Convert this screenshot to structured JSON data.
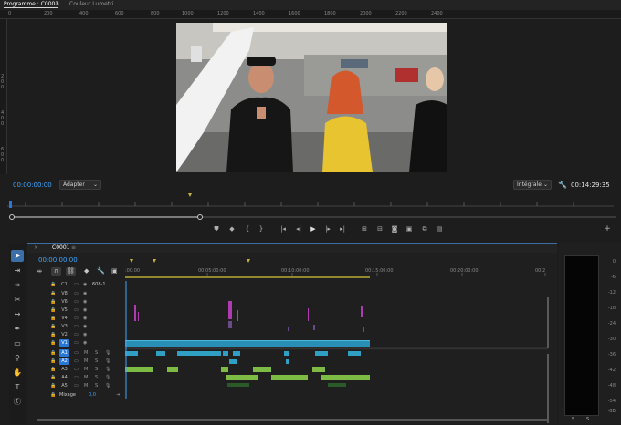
{
  "monitor": {
    "tab_program": "Programme : C0001",
    "tab_menu_icon": "≡",
    "tab_lumetri": "Couleur Lumetri",
    "ruler_labels": [
      "0",
      "200",
      "400",
      "600",
      "800",
      "1000",
      "1200",
      "1400",
      "1600",
      "1800",
      "2000",
      "2200",
      "2400"
    ],
    "ruler_left_labels": [
      "2",
      "0",
      "0",
      "4",
      "0",
      "0",
      "6",
      "0",
      "0"
    ],
    "timecode_left": "00:00:00:00",
    "fit_select": "Adapter",
    "quality_select": "Intégrale",
    "timecode_right": "00:14:29:35",
    "transport_icons": [
      "mark-in-icon",
      "marker-icon",
      "in-brace-icon",
      "out-brace-icon",
      "go-to-in-icon",
      "step-back-icon",
      "play-icon",
      "step-forward-icon",
      "go-to-out-icon",
      "lift-icon",
      "extract-icon",
      "export-frame-icon",
      "compare-icon",
      "multi-cam-icon",
      "settings-icon",
      "add-icon"
    ]
  },
  "timeline": {
    "tab": "C0001",
    "tab_menu_icon": "≡",
    "timecode": "00:00:00:00",
    "ruler_labels": [
      ":00:00",
      "00:05:00:00",
      "00:10:00:00",
      "00:15:00:00",
      "00:20:00:00",
      "00:2"
    ],
    "v1_source": "608-1",
    "video_tracks": [
      "C1",
      "V8",
      "V6",
      "V5",
      "V4",
      "V3",
      "V2",
      "V1"
    ],
    "audio_tracks": [
      "A1",
      "A2",
      "A3",
      "A4",
      "A5"
    ],
    "mix_label": "Mixage",
    "mix_value": "0,0",
    "meter_labels": [
      "0",
      "-6",
      "-12",
      "-18",
      "-24",
      "-30",
      "-36",
      "-42",
      "-48",
      "-54",
      "-dB"
    ],
    "meter_footer": [
      "S",
      "S"
    ]
  },
  "tools": [
    "selection-tool",
    "track-select-tool",
    "ripple-edit-tool",
    "razor-tool",
    "slip-tool",
    "pen-tool",
    "rectangle-tool",
    "hand-tool",
    "zoom-tool",
    "type-tool"
  ],
  "colors": {
    "accent": "#2a78d6",
    "timecode": "#3da7ff",
    "video_clip": "#2a8fb6",
    "audio_clip": "#7dbb45",
    "overlay_clip": "#b03ab0"
  }
}
